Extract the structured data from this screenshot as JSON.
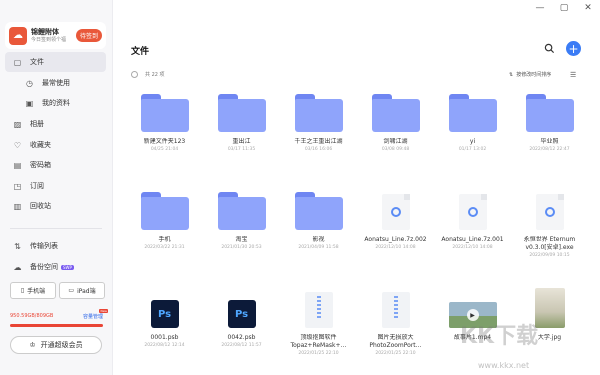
{
  "sidebar": {
    "user": {
      "name": "锦鲤附体",
      "subtitle": "今日签到领个福",
      "sign_label": "待签到"
    },
    "nav": [
      {
        "label": "文件",
        "icon": "file-icon"
      },
      {
        "label": "最常使用",
        "icon": "clock-icon"
      },
      {
        "label": "我的资料",
        "icon": "profile-icon"
      },
      {
        "label": "相册",
        "icon": "photo-icon"
      },
      {
        "label": "收藏夹",
        "icon": "heart-icon"
      },
      {
        "label": "密码箱",
        "icon": "safe-icon"
      },
      {
        "label": "订阅",
        "icon": "rss-icon"
      },
      {
        "label": "回收站",
        "icon": "trash-icon"
      },
      {
        "label": "传输列表",
        "icon": "transfer-icon"
      },
      {
        "label": "备份空间",
        "icon": "cloud-icon",
        "badge": "SWP"
      }
    ],
    "devices": {
      "phone": "手机端",
      "ipad": "iPad端"
    },
    "quota": {
      "used": "950.59GB/809GB",
      "upgrade": "容量管理",
      "new_tag": "New"
    },
    "vip_label": "开通超级会员"
  },
  "main": {
    "title": "文件",
    "count_label": "共 22 项",
    "sort_label": "按修改时间排序",
    "items": [
      {
        "name": "新建文件夹123",
        "date": "04/25 21:04",
        "type": "folder"
      },
      {
        "name": "重出江",
        "date": "03/17 11:35",
        "type": "folder"
      },
      {
        "name": "千王之王重出江湖",
        "date": "03/16 16:06",
        "type": "folder"
      },
      {
        "name": "剑啸江湖",
        "date": "03/08 09:48",
        "type": "folder"
      },
      {
        "name": "yi",
        "date": "01/17 13:02",
        "type": "folder"
      },
      {
        "name": "毕业照",
        "date": "2022/08/12 22:47",
        "type": "folder"
      },
      {
        "name": "手机",
        "date": "2022/03/22 21:31",
        "type": "folder"
      },
      {
        "name": "淘宝",
        "date": "2021/01/30 20:53",
        "type": "folder"
      },
      {
        "name": "影视",
        "date": "2021/04/09 11:58",
        "type": "folder"
      },
      {
        "name": "Aonatsu_Line.7z.002",
        "date": "2022/12/10 14:08",
        "type": "doc"
      },
      {
        "name": "Aonatsu_Line.7z.001",
        "date": "2022/12/10 14:08",
        "type": "doc"
      },
      {
        "name": "永恒世界 Eternum v0.3.0[安卓].exe",
        "date": "2022/09/09 10:15",
        "type": "doc"
      },
      {
        "name": "0001.psb",
        "date": "2022/08/12 12:14",
        "type": "ps"
      },
      {
        "name": "0042.psb",
        "date": "2022/08/12 11:57",
        "type": "ps"
      },
      {
        "name": "顶级抠图软件Topaz+ReMask+…",
        "date": "2022/01/25 22:10",
        "type": "zip"
      },
      {
        "name": "图片无损放大PhotoZoomPort…",
        "date": "2022/01/25 22:10",
        "type": "zip"
      },
      {
        "name": "故事片1.mp4",
        "date": "",
        "type": "video"
      },
      {
        "name": "大学.jpg",
        "date": "",
        "type": "image"
      }
    ]
  },
  "watermark": {
    "text": "KK下载",
    "url": "www.kkx.net"
  }
}
